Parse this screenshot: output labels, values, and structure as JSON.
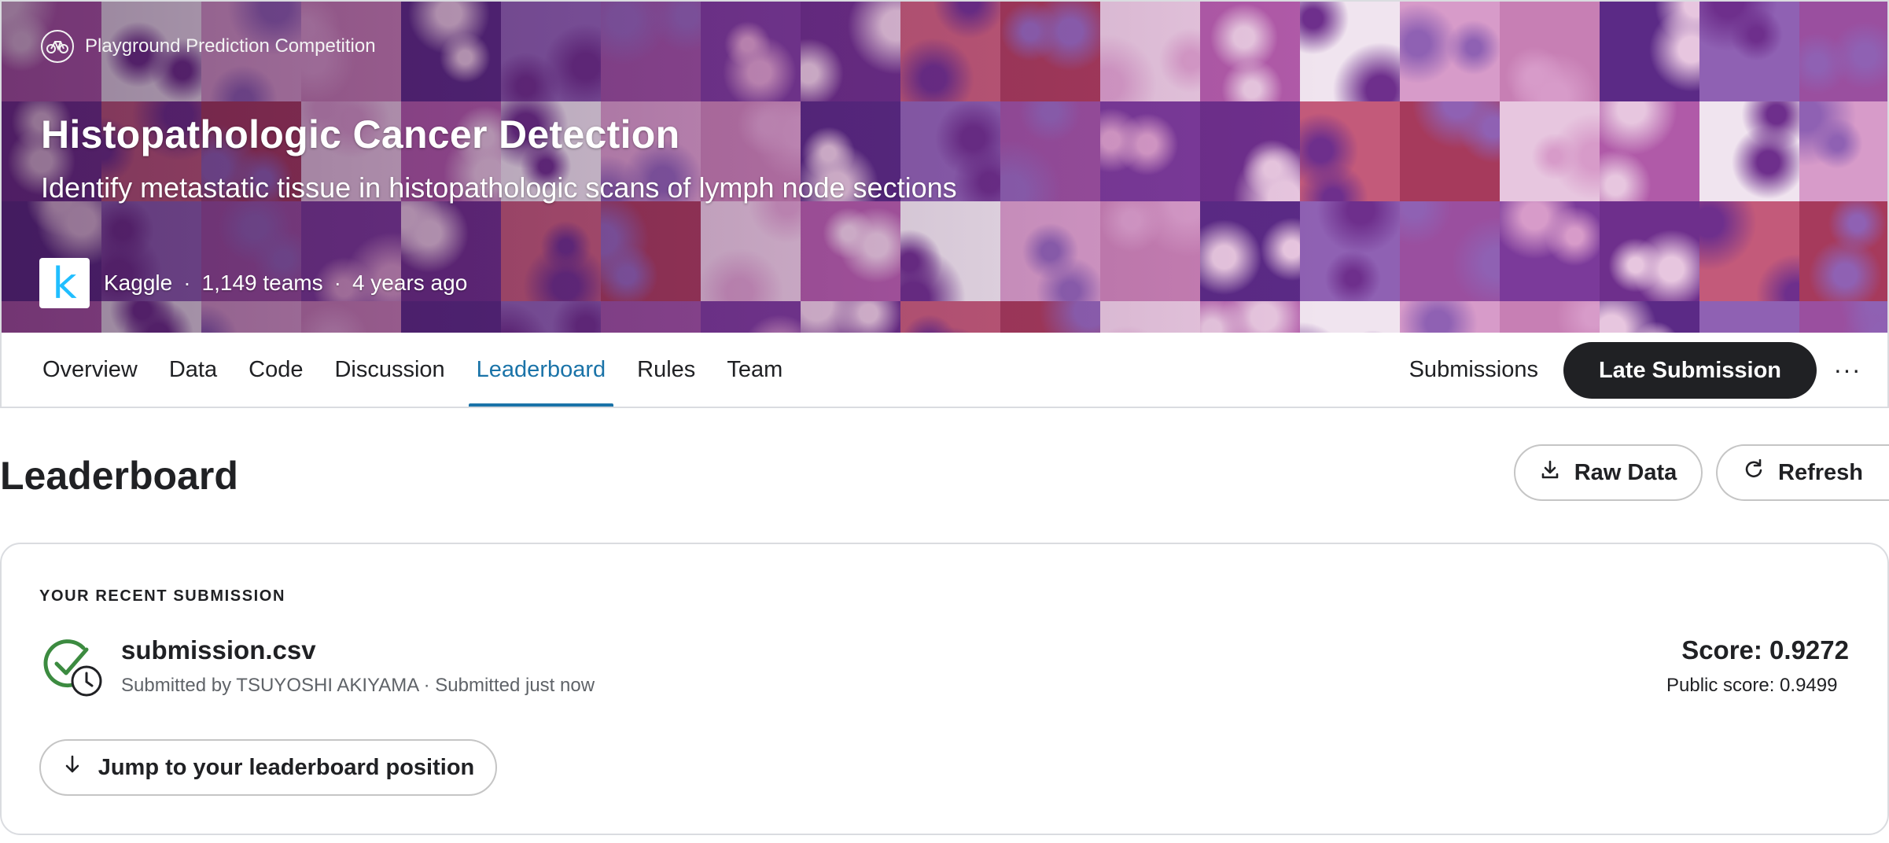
{
  "banner": {
    "competition_type": "Playground Prediction Competition",
    "competition_icon": "bike-icon",
    "title": "Histopathologic Cancer Detection",
    "subtitle": "Identify metastatic tissue in histopathologic scans of lymph node sections",
    "host_logo_letter": "k",
    "host": "Kaggle",
    "teams": "1,149 teams",
    "age": "4 years ago",
    "tile_colors": [
      "#b05aa8",
      "#7b3a9a",
      "#d79bc9",
      "#c35a7a",
      "#5b2a86",
      "#e7c6df",
      "#9a4f9f",
      "#f0e4ef",
      "#6e2f8c",
      "#c77fb4",
      "#a63a5c",
      "#8f61b3"
    ]
  },
  "tabs": {
    "items": [
      {
        "label": "Overview"
      },
      {
        "label": "Data"
      },
      {
        "label": "Code"
      },
      {
        "label": "Discussion"
      },
      {
        "label": "Leaderboard",
        "active": true
      },
      {
        "label": "Rules"
      },
      {
        "label": "Team"
      }
    ],
    "submissions_label": "Submissions",
    "late_submission_label": "Late Submission",
    "more_label": "···"
  },
  "leaderboard": {
    "title": "Leaderboard",
    "raw_data_label": "Raw Data",
    "refresh_label": "Refresh"
  },
  "recent_submission": {
    "section_label": "YOUR RECENT SUBMISSION",
    "file_name": "submission.csv",
    "submitted_by": "Submitted by TSUYOSHI AKIYAMA · Submitted just now",
    "score": "Score: 0.9272",
    "public_score": "Public score: 0.9499",
    "jump_label": "Jump to your leaderboard position"
  },
  "colors": {
    "accent": "#1a73a8",
    "success": "#3c8b40",
    "dark_button": "#202124"
  }
}
